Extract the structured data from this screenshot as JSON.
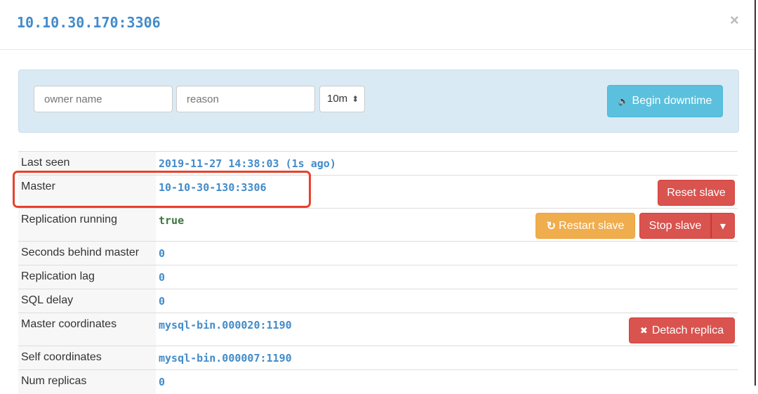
{
  "title": "10.10.30.170:3306",
  "close_label": "×",
  "downtime": {
    "owner_placeholder": "owner name",
    "reason_placeholder": "reason",
    "duration": "10m",
    "duration_arrows": "⬍",
    "begin_label": "Begin downtime",
    "begin_icon": "🔈"
  },
  "rows": [
    {
      "label": "Last seen",
      "value": "2019-11-27 14:38:03 (1s ago)"
    },
    {
      "label": "Master",
      "value": "10-10-30-130:3306"
    },
    {
      "label": "Replication running",
      "value": "true"
    },
    {
      "label": "Seconds behind master",
      "value": "0"
    },
    {
      "label": "Replication lag",
      "value": "0"
    },
    {
      "label": "SQL delay",
      "value": "0"
    },
    {
      "label": "Master coordinates",
      "value": "mysql-bin.000020:1190"
    },
    {
      "label": "Self coordinates",
      "value": "mysql-bin.000007:1190"
    },
    {
      "label": "Num replicas",
      "value": "0"
    }
  ],
  "buttons": {
    "reset_slave": "Reset slave",
    "restart_slave": "Restart slave",
    "restart_icon": "↻",
    "stop_slave": "Stop slave",
    "caret": "▾",
    "detach_replica": "Detach replica",
    "detach_icon": "✖"
  }
}
